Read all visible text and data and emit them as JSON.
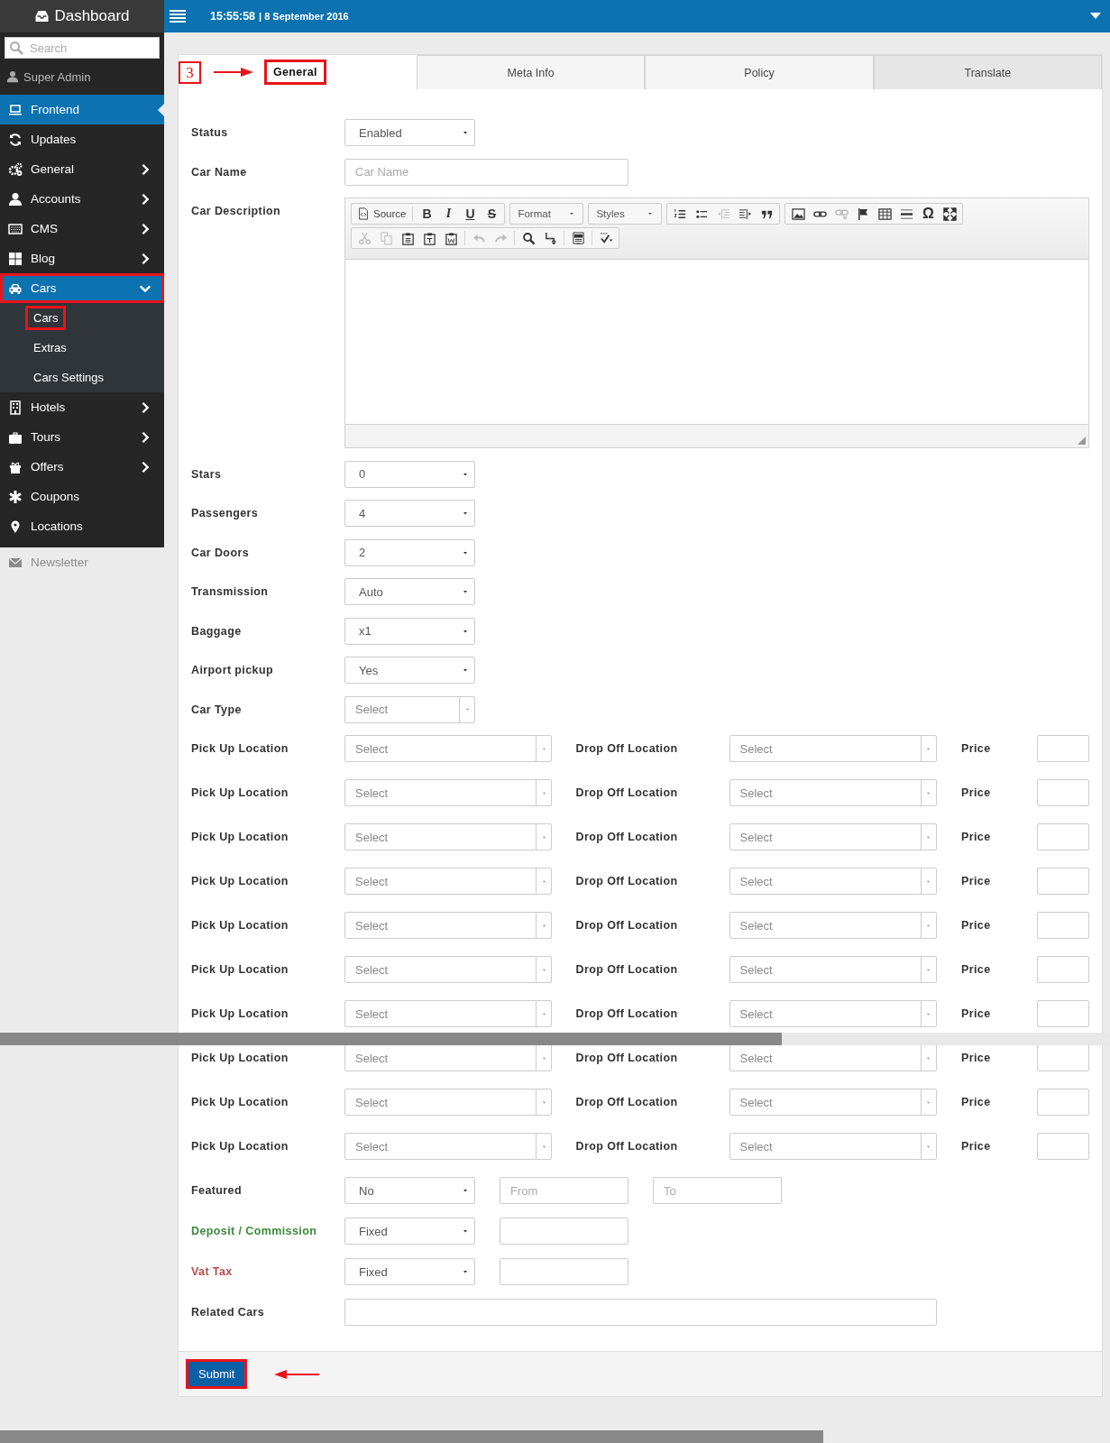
{
  "sidebar": {
    "title": "Dashboard",
    "search": {
      "placeholder": "Search"
    },
    "user": "Super Admin",
    "items": [
      {
        "label": "Frontend",
        "selected": true,
        "expandable": false,
        "annotated": false,
        "faded": false
      },
      {
        "label": "Updates",
        "selected": false,
        "expandable": false,
        "annotated": false,
        "faded": false
      },
      {
        "label": "General",
        "selected": false,
        "expandable": true,
        "expanded": false,
        "annotated": false,
        "faded": false
      },
      {
        "label": "Accounts",
        "selected": false,
        "expandable": true,
        "expanded": false,
        "annotated": false,
        "faded": false
      },
      {
        "label": "CMS",
        "selected": false,
        "expandable": true,
        "expanded": false,
        "annotated": false,
        "faded": false
      },
      {
        "label": "Blog",
        "selected": false,
        "expandable": true,
        "expanded": false,
        "annotated": false,
        "faded": false
      },
      {
        "label": "Cars",
        "selected": false,
        "expandable": true,
        "expanded": true,
        "annotated": true,
        "faded": false,
        "children": [
          {
            "label": "Cars",
            "annotated": true
          },
          {
            "label": "Extras",
            "annotated": false
          },
          {
            "label": "Cars Settings",
            "annotated": false
          }
        ]
      },
      {
        "label": "Hotels",
        "selected": false,
        "expandable": true,
        "expanded": false,
        "annotated": false,
        "faded": false
      },
      {
        "label": "Tours",
        "selected": false,
        "expandable": true,
        "expanded": false,
        "annotated": false,
        "faded": false
      },
      {
        "label": "Offers",
        "selected": false,
        "expandable": true,
        "expanded": false,
        "annotated": false,
        "faded": false
      },
      {
        "label": "Coupons",
        "selected": false,
        "expandable": false,
        "annotated": false,
        "faded": false
      },
      {
        "label": "Locations",
        "selected": false,
        "expandable": false,
        "annotated": false,
        "faded": false
      },
      {
        "label": "Newsletter",
        "selected": false,
        "expandable": false,
        "annotated": false,
        "faded": true
      }
    ]
  },
  "header": {
    "time": "15:55:58",
    "date": "| 8 September 2016"
  },
  "tabs": [
    {
      "label": "General",
      "selected": true,
      "hovered": false,
      "step": "3"
    },
    {
      "label": "Meta Info",
      "selected": false,
      "hovered": false
    },
    {
      "label": "Policy",
      "selected": false,
      "hovered": false
    },
    {
      "label": "Translate",
      "selected": false,
      "hovered": true
    }
  ],
  "form": {
    "fields": [
      {
        "kind": "select",
        "label": "Status",
        "value": "Enabled"
      },
      {
        "kind": "text",
        "label": "Car Name",
        "placeholder": "Car Name"
      },
      {
        "kind": "editor",
        "label": "Car Description",
        "toolbar": [
          [
            {
              "items": [
                {
                  "kind": "icon-text",
                  "label": "Source",
                  "disabled": false
                },
                {
                  "kind": "bold",
                  "label": "B",
                  "disabled": false
                },
                {
                  "kind": "italic",
                  "label": "I",
                  "disabled": false
                },
                {
                  "kind": "underline",
                  "label": "U",
                  "disabled": false
                },
                {
                  "kind": "strike",
                  "label": "S",
                  "disabled": false
                }
              ]
            },
            {
              "items": [
                {
                  "kind": "dropdown",
                  "label": "Format",
                  "disabled": false
                }
              ]
            },
            {
              "items": [
                {
                  "kind": "dropdown",
                  "label": "Styles",
                  "disabled": false
                }
              ]
            },
            {
              "items": [
                {
                  "kind": "icon",
                  "disabled": false
                },
                {
                  "kind": "icon",
                  "disabled": false
                },
                {
                  "kind": "icon",
                  "disabled": true
                },
                {
                  "kind": "icon",
                  "disabled": false
                },
                {
                  "kind": "icon",
                  "disabled": false
                }
              ]
            },
            {
              "items": [
                {
                  "kind": "icon",
                  "disabled": false
                },
                {
                  "kind": "icon",
                  "disabled": false
                },
                {
                  "kind": "icon",
                  "disabled": true
                },
                {
                  "kind": "icon",
                  "disabled": false
                },
                {
                  "kind": "icon",
                  "disabled": false
                },
                {
                  "kind": "icon",
                  "disabled": false
                },
                {
                  "kind": "text",
                  "label": "Ω",
                  "disabled": false
                },
                {
                  "kind": "icon",
                  "disabled": false
                }
              ]
            }
          ],
          [
            {
              "items": [
                {
                  "kind": "icon",
                  "disabled": true
                },
                {
                  "kind": "icon",
                  "disabled": true
                },
                {
                  "kind": "icon",
                  "disabled": false
                },
                {
                  "kind": "icon",
                  "disabled": false
                },
                {
                  "kind": "icon",
                  "disabled": false
                },
                {
                  "kind": "icon",
                  "disabled": true
                },
                {
                  "kind": "icon",
                  "disabled": true
                },
                {
                  "kind": "icon",
                  "disabled": false
                },
                {
                  "kind": "icon",
                  "disabled": false
                },
                {
                  "kind": "icon",
                  "disabled": false
                },
                {
                  "kind": "icon",
                  "disabled": false
                }
              ]
            }
          ]
        ]
      },
      {
        "kind": "select",
        "label": "Stars",
        "value": "0"
      },
      {
        "kind": "select",
        "label": "Passengers",
        "value": "4"
      },
      {
        "kind": "select",
        "label": "Car Doors",
        "value": "2"
      },
      {
        "kind": "select",
        "label": "Transmission",
        "value": "Auto"
      },
      {
        "kind": "select",
        "label": "Baggage",
        "value": "x1"
      },
      {
        "kind": "select",
        "label": "Airport pickup",
        "value": "Yes"
      },
      {
        "kind": "chosen",
        "label": "Car Type",
        "value": "Select"
      },
      {
        "kind": "route",
        "pickup_label": "Pick Up Location",
        "pickup": "Select",
        "dropoff_label": "Drop Off Location",
        "dropoff": "Select",
        "price_label": "Price"
      },
      {
        "kind": "route",
        "pickup_label": "Pick Up Location",
        "pickup": "Select",
        "dropoff_label": "Drop Off Location",
        "dropoff": "Select",
        "price_label": "Price"
      },
      {
        "kind": "route",
        "pickup_label": "Pick Up Location",
        "pickup": "Select",
        "dropoff_label": "Drop Off Location",
        "dropoff": "Select",
        "price_label": "Price"
      },
      {
        "kind": "route",
        "pickup_label": "Pick Up Location",
        "pickup": "Select",
        "dropoff_label": "Drop Off Location",
        "dropoff": "Select",
        "price_label": "Price"
      },
      {
        "kind": "route",
        "pickup_label": "Pick Up Location",
        "pickup": "Select",
        "dropoff_label": "Drop Off Location",
        "dropoff": "Select",
        "price_label": "Price"
      },
      {
        "kind": "route",
        "pickup_label": "Pick Up Location",
        "pickup": "Select",
        "dropoff_label": "Drop Off Location",
        "dropoff": "Select",
        "price_label": "Price"
      },
      {
        "kind": "route",
        "pickup_label": "Pick Up Location",
        "pickup": "Select",
        "dropoff_label": "Drop Off Location",
        "dropoff": "Select",
        "price_label": "Price"
      },
      {
        "kind": "route",
        "pickup_label": "Pick Up Location",
        "pickup": "Select",
        "dropoff_label": "Drop Off Location",
        "dropoff": "Select",
        "price_label": "Price"
      },
      {
        "kind": "route",
        "pickup_label": "Pick Up Location",
        "pickup": "Select",
        "dropoff_label": "Drop Off Location",
        "dropoff": "Select",
        "price_label": "Price"
      },
      {
        "kind": "route",
        "pickup_label": "Pick Up Location",
        "pickup": "Select",
        "dropoff_label": "Drop Off Location",
        "dropoff": "Select",
        "price_label": "Price"
      },
      {
        "kind": "featured",
        "label": "Featured",
        "value": "No",
        "from_placeholder": "From",
        "to_placeholder": "To"
      },
      {
        "kind": "select-input",
        "label": "Deposit / Commission",
        "color": "#3c8b3c",
        "value": "Fixed"
      },
      {
        "kind": "select-input",
        "label": "Vat Tax",
        "color": "#b94a48",
        "value": "Fixed"
      },
      {
        "kind": "wide-input",
        "label": "Related Cars"
      }
    ]
  },
  "footer": {
    "submit": {
      "label": "Submit",
      "annotated": true
    }
  }
}
